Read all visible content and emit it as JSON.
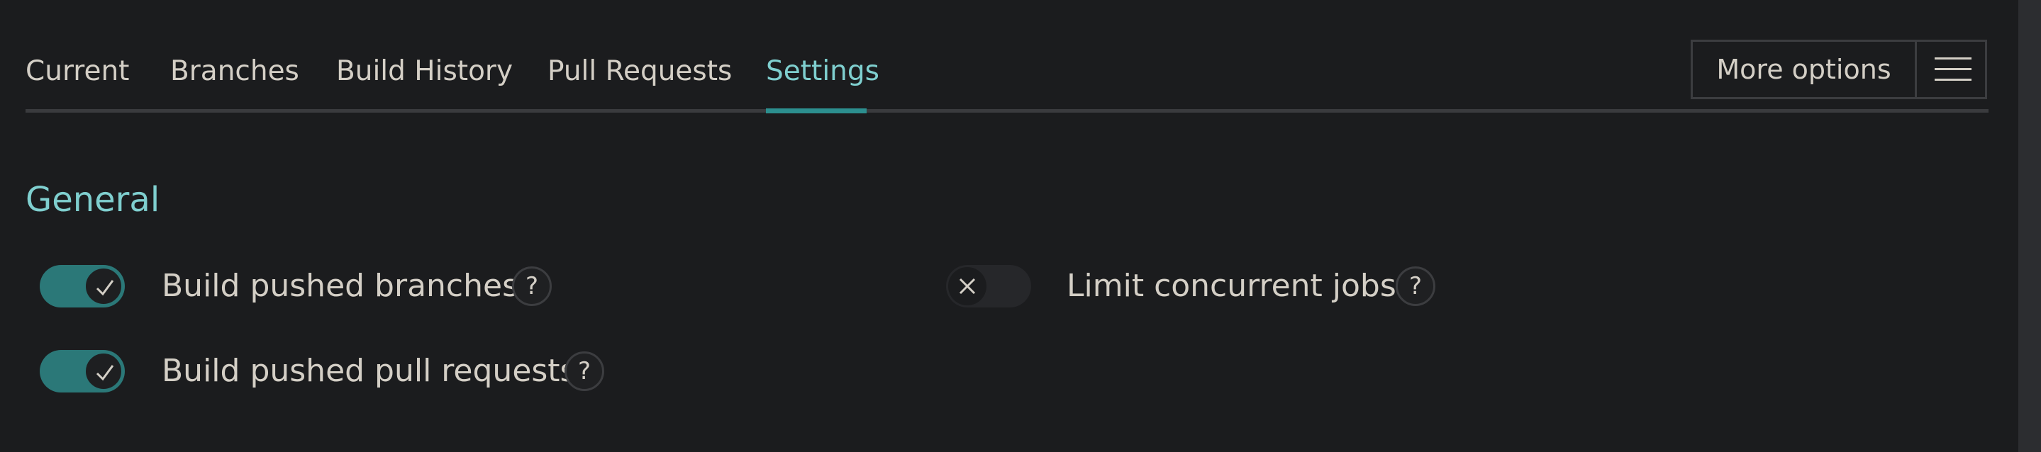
{
  "tabs": [
    {
      "label": "Current",
      "active": false
    },
    {
      "label": "Branches",
      "active": false
    },
    {
      "label": "Build History",
      "active": false
    },
    {
      "label": "Pull Requests",
      "active": false
    },
    {
      "label": "Settings",
      "active": true
    }
  ],
  "header": {
    "more_options_label": "More options",
    "menu_icon": "hamburger-icon"
  },
  "section": {
    "title": "General"
  },
  "settings": [
    {
      "label": "Build pushed branches",
      "enabled": true,
      "help": "?"
    },
    {
      "label": "Build pushed pull requests",
      "enabled": true,
      "help": "?"
    },
    {
      "label": "Limit concurrent jobs",
      "enabled": false,
      "help": "?"
    }
  ],
  "colors": {
    "background": "#1b1c1e",
    "accent": "#7fcfcf",
    "toggle_on": "#2b7878",
    "text": "#d4cfc6"
  }
}
